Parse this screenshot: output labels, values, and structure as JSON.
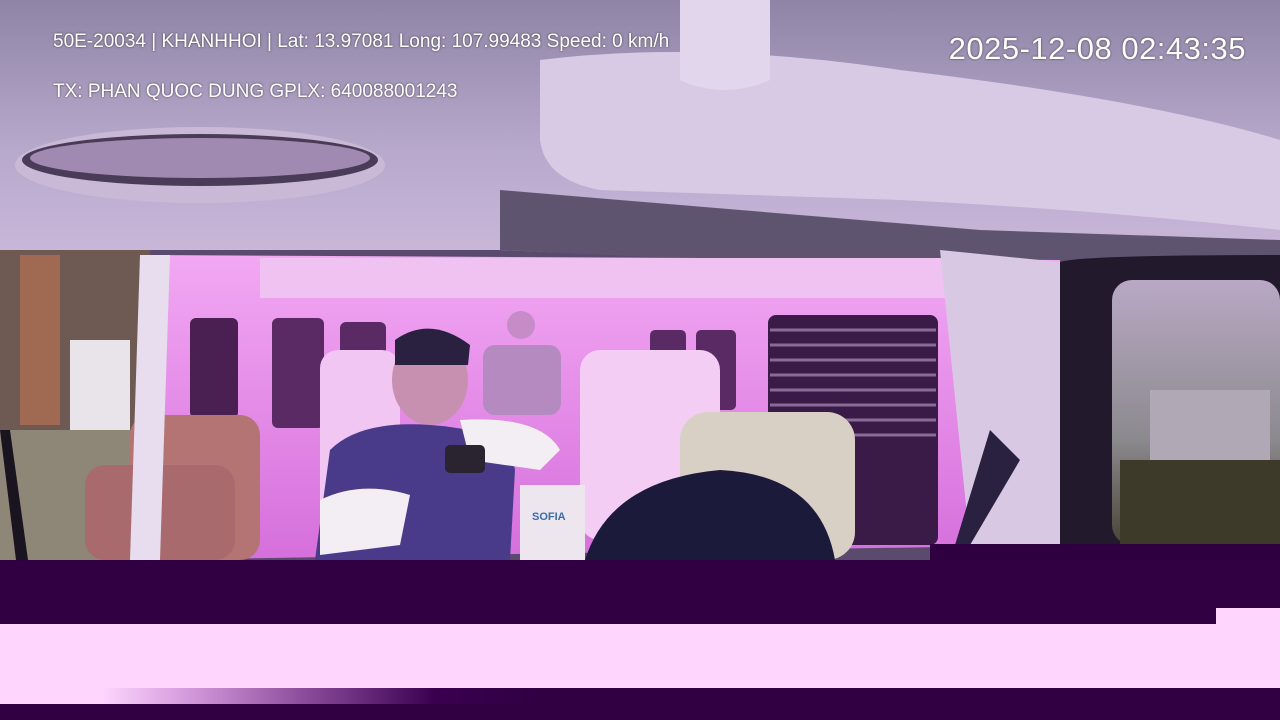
{
  "overlay": {
    "vehicle_line": "50E-20034 | KHANHHOI | Lat: 13.97081 Long: 107.99483 Speed: 0 km/h",
    "driver_line": "TX: PHAN QUOC DUNG GPLX: 640088001243",
    "timestamp": "2025-12-08 02:43:35"
  },
  "scene": {
    "description_colors": {
      "cabin_light": "#e27ae8",
      "ceiling": "#c8b4d8",
      "shadow": "#3a1a4a",
      "band_dark": "#300043",
      "band_light": "#fdd5fd"
    },
    "box_label": "SOFIA"
  }
}
